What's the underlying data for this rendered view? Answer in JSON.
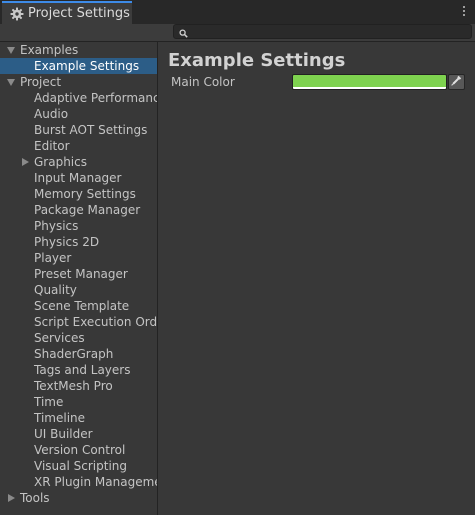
{
  "window": {
    "tab_title": "Project Settings",
    "tab_icon": "gear-icon",
    "menu_icon": "kebab-menu-icon"
  },
  "search": {
    "placeholder": "",
    "value": "",
    "icon": "search-icon"
  },
  "sidebar": {
    "groups": [
      {
        "label": "Examples",
        "expanded": true,
        "items": [
          {
            "label": "Example Settings",
            "selected": true
          }
        ]
      },
      {
        "label": "Project",
        "expanded": true,
        "items": [
          {
            "label": "Adaptive Performance"
          },
          {
            "label": "Audio"
          },
          {
            "label": "Burst AOT Settings"
          },
          {
            "label": "Editor"
          },
          {
            "label": "Graphics",
            "collapsed_children": true
          },
          {
            "label": "Input Manager"
          },
          {
            "label": "Memory Settings"
          },
          {
            "label": "Package Manager"
          },
          {
            "label": "Physics"
          },
          {
            "label": "Physics 2D"
          },
          {
            "label": "Player"
          },
          {
            "label": "Preset Manager"
          },
          {
            "label": "Quality"
          },
          {
            "label": "Scene Template"
          },
          {
            "label": "Script Execution Order"
          },
          {
            "label": "Services"
          },
          {
            "label": "ShaderGraph"
          },
          {
            "label": "Tags and Layers"
          },
          {
            "label": "TextMesh Pro"
          },
          {
            "label": "Time"
          },
          {
            "label": "Timeline"
          },
          {
            "label": "UI Builder"
          },
          {
            "label": "Version Control"
          },
          {
            "label": "Visual Scripting"
          },
          {
            "label": "XR Plugin Management"
          }
        ]
      },
      {
        "label": "Tools",
        "expanded": false,
        "items": []
      }
    ]
  },
  "main": {
    "title": "Example Settings",
    "properties": [
      {
        "label": "Main Color",
        "type": "color",
        "color": "#7ed24f",
        "alpha": 1.0,
        "picker_icon": "eyedropper-icon"
      }
    ]
  },
  "colors": {
    "accent": "#3d8be8",
    "selection": "#2c5d87",
    "background": "#383838"
  }
}
